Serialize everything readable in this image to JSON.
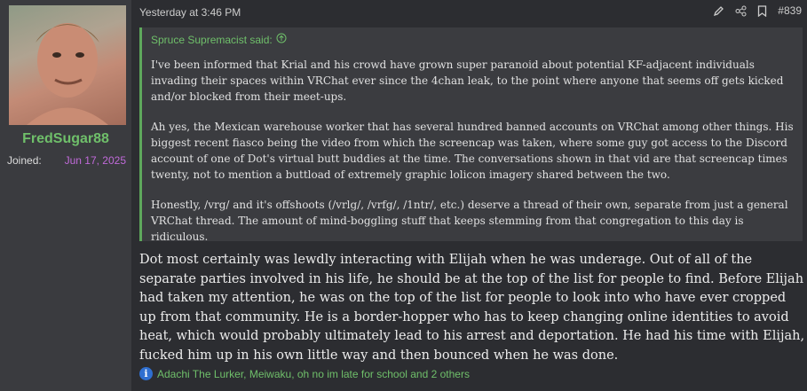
{
  "user": {
    "name": "FredSugar88",
    "joined_label": "Joined:",
    "joined_date": "Jun 17, 2025"
  },
  "post": {
    "timestamp": "Yesterday at 3:46 PM",
    "number": "#839",
    "icons": [
      "edit-icon",
      "share-icon",
      "bookmark-icon"
    ]
  },
  "quote": {
    "author": "Spruce Supremacist said:",
    "paragraphs": [
      "I've been informed that Krial and his crowd have grown super paranoid about potential KF-adjacent individuals invading their spaces within VRChat ever since the 4chan leak, to the point where anyone that seems off gets kicked and/or blocked from their meet-ups.",
      "Ah yes, the Mexican warehouse worker that has several hundred banned accounts on VRChat among other things. His biggest recent fiasco being the video from which the screencap was taken, where some guy got access to the Discord account of one of Dot's virtual butt buddies at the time. The conversations shown in that vid are that screencap times twenty, not to mention a buttload of extremely graphic lolicon imagery shared between the two.",
      "Honestly, /vrg/ and it's offshoots (/vrlg/, /vrfg/, /1ntr/, etc.) deserve a thread of their own, separate from just a general VRChat thread. The amount of mind-boggling stuff that keeps stemming from that congregation to this day is ridiculous."
    ]
  },
  "body": "Dot most certainly was lewdly interacting with Elijah when he was underage. Out of all of the separate parties involved in his life, he should be at the top of the list for people to find. Before Elijah had taken my attention, he was on the top of the list for people to look into who have ever cropped up from that community. He is a border-hopper who has to keep changing online identities to avoid heat, which would probably ultimately lead to his arrest and deportation. He had his time with Elijah, fucked him up in his own little way and then bounced when he was done.",
  "reactions": "Adachi The Lurker, Meiwaku, oh no im late for school and 2 others",
  "colors": {
    "accent": "#6fbf6a",
    "date": "#c06ad9",
    "info": "#2f6fd0"
  }
}
